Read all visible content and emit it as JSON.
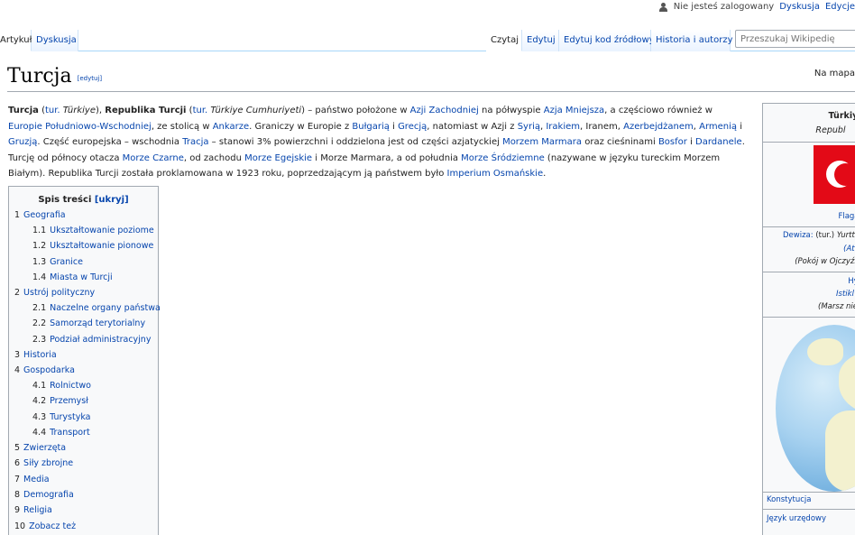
{
  "personal": {
    "not_logged": "Nie jesteś zalogowany",
    "discussion": "Dyskusja",
    "edits": "Edycje"
  },
  "tabs": {
    "article": "Artykuł",
    "discussion": "Dyskusja",
    "read": "Czytaj",
    "edit": "Edytuj",
    "edit_source": "Edytuj kod źródłowy",
    "history": "Historia i autorzy"
  },
  "search": {
    "placeholder": "Przeszukaj Wikipedię"
  },
  "heading": {
    "title": "Turcja",
    "edit": "[edytuj]",
    "right": "Na mapa"
  },
  "intro": {
    "t1": "Turcja",
    "t2": " (",
    "t3": "tur.",
    "t4": " Türkiye",
    "t5": "), ",
    "t6": "Republika Turcji",
    "t7": " (",
    "t8": "tur.",
    "t9": " Türkiye Cumhuriyeti",
    "t10": ") – państwo położone w ",
    "t11": "Azji Zachodniej",
    "t12": " na półwyspie ",
    "t13": "Azja Mniejsza",
    "t14": ", a częściowo również w ",
    "t15": "Europie Południowo-Wschodniej",
    "t16": ", ze stolicą w ",
    "t17": "Ankarze",
    "t18": ". Graniczy w Europie z ",
    "t19": "Bułgarią",
    "t20": " i ",
    "t21": "Grecją",
    "t22": ", natomiast w Azji z ",
    "t23": "Syrią",
    "t24": ", ",
    "t25": "Irakiem",
    "t26": ", Iranem, ",
    "t27": "Azerbejdżanem",
    "t28": ", ",
    "t29": "Armenią",
    "t30": " i ",
    "t31": "Gruzją",
    "t32": ". Część europejska – wschodnia ",
    "t33": "Tracja",
    "t34": " – stanowi 3% powierzchni i oddzielona jest od części azjatyckiej ",
    "t35": "Morzem Marmara",
    "t36": " oraz cieśninami ",
    "t37": "Bosfor",
    "t38": " i ",
    "t39": "Dardanele",
    "t40": ". Turcję od północy otacza ",
    "t41": "Morze Czarne",
    "t42": ", od zachodu ",
    "t43": "Morze Egejskie",
    "t44": " i Morze Marmara, a od południa ",
    "t45": "Morze Śródziemne",
    "t46": " (nazywane w języku tureckim Morzem Białym). Republika Turcji została proklamowana w 1923 roku, poprzedzającym ją państwem było ",
    "t47": "Imperium Osmańskie",
    "t48": "."
  },
  "toc": {
    "title": "Spis treści",
    "toggle": "[ukryj]",
    "items": [
      {
        "num": "1",
        "label": "Geografia"
      },
      {
        "num": "1.1",
        "label": "Ukształtowanie poziome"
      },
      {
        "num": "1.2",
        "label": "Ukształtowanie pionowe"
      },
      {
        "num": "1.3",
        "label": "Granice"
      },
      {
        "num": "1.4",
        "label": "Miasta w Turcji"
      },
      {
        "num": "2",
        "label": "Ustrój polityczny"
      },
      {
        "num": "2.1",
        "label": "Naczelne organy państwa"
      },
      {
        "num": "2.2",
        "label": "Samorząd terytorialny"
      },
      {
        "num": "2.3",
        "label": "Podział administracyjny"
      },
      {
        "num": "3",
        "label": "Historia"
      },
      {
        "num": "4",
        "label": "Gospodarka"
      },
      {
        "num": "4.1",
        "label": "Rolnictwo"
      },
      {
        "num": "4.2",
        "label": "Przemysł"
      },
      {
        "num": "4.3",
        "label": "Turystyka"
      },
      {
        "num": "4.4",
        "label": "Transport"
      },
      {
        "num": "5",
        "label": "Zwierzęta"
      },
      {
        "num": "6",
        "label": "Siły zbrojne"
      },
      {
        "num": "7",
        "label": "Media"
      },
      {
        "num": "8",
        "label": "Demografia"
      },
      {
        "num": "9",
        "label": "Religia"
      },
      {
        "num": "10",
        "label": "Zobacz też"
      }
    ]
  },
  "infobox": {
    "name": "Türkiye C",
    "name2": "Republ",
    "flag_label": "Flaga",
    "motto_label": "Dewiza:",
    "motto_tur": "(tur.)",
    "motto_text": "Yurtta",
    "motto_link": "(Ata",
    "motto_trans": "(Pokój w Ojczyźn",
    "anthem_label": "Hy",
    "anthem_link": "Istikl",
    "anthem_trans": "(Marsz nie",
    "constitution": "Konstytucja",
    "official_lang": "Język urzędowy"
  }
}
